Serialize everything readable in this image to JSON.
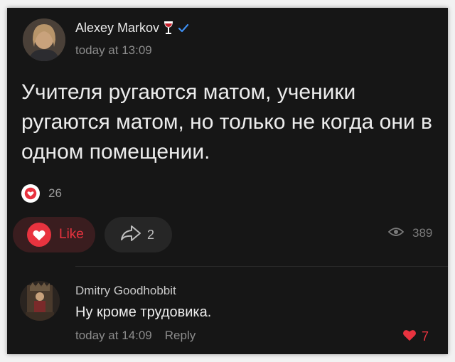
{
  "post": {
    "author": "Alexey Markov",
    "time": "today at 13:09",
    "text": "Учителя ругаются матом, ученики ругаются матом, но только не когда они в одном помещении.",
    "reaction_count": "26"
  },
  "actions": {
    "like_label": "Like",
    "share_count": "2",
    "views": "389"
  },
  "comment": {
    "author": "Dmitry Goodhobbit",
    "text": "Ну кроме трудовика.",
    "time": "today at 14:09",
    "reply_label": "Reply",
    "like_count": "7"
  },
  "colors": {
    "background": "#161616",
    "accent": "#e8333f",
    "verified": "#3d8ef0"
  }
}
